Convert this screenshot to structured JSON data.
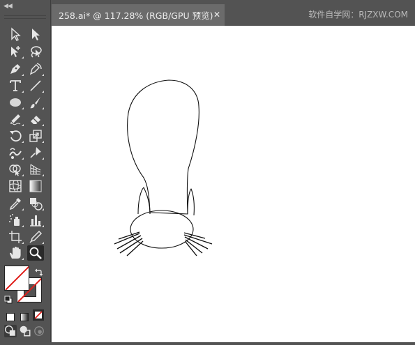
{
  "document": {
    "tab_title": "258.ai* @ 117.28% (RGB/GPU 预览)",
    "close_glyph": "✕"
  },
  "watermark": "软件自学网：RJZXW.COM",
  "toolbar": {
    "collapse_glyph": "◀◀",
    "tools": [
      "selection-tool",
      "direct-selection-tool",
      "group-selection-tool",
      "lasso-tool",
      "pen-tool",
      "curvature-tool",
      "type-tool",
      "line-segment-tool",
      "ellipse-tool",
      "paintbrush-tool",
      "pencil-tool",
      "eraser-tool",
      "rotate-tool",
      "scale-tool",
      "warp-tool",
      "puppet-warp-tool",
      "shape-builder-tool",
      "perspective-grid-tool",
      "mesh-tool",
      "gradient-tool",
      "eyedropper-tool",
      "blend-tool",
      "symbol-sprayer-tool",
      "column-graph-tool",
      "artboard-tool",
      "slice-tool",
      "hand-tool",
      "zoom-tool"
    ],
    "active_tool": "zoom-tool"
  },
  "colors": {
    "ui_background": "#535353",
    "canvas": "#ffffff",
    "none_slash": "#e0201c"
  }
}
